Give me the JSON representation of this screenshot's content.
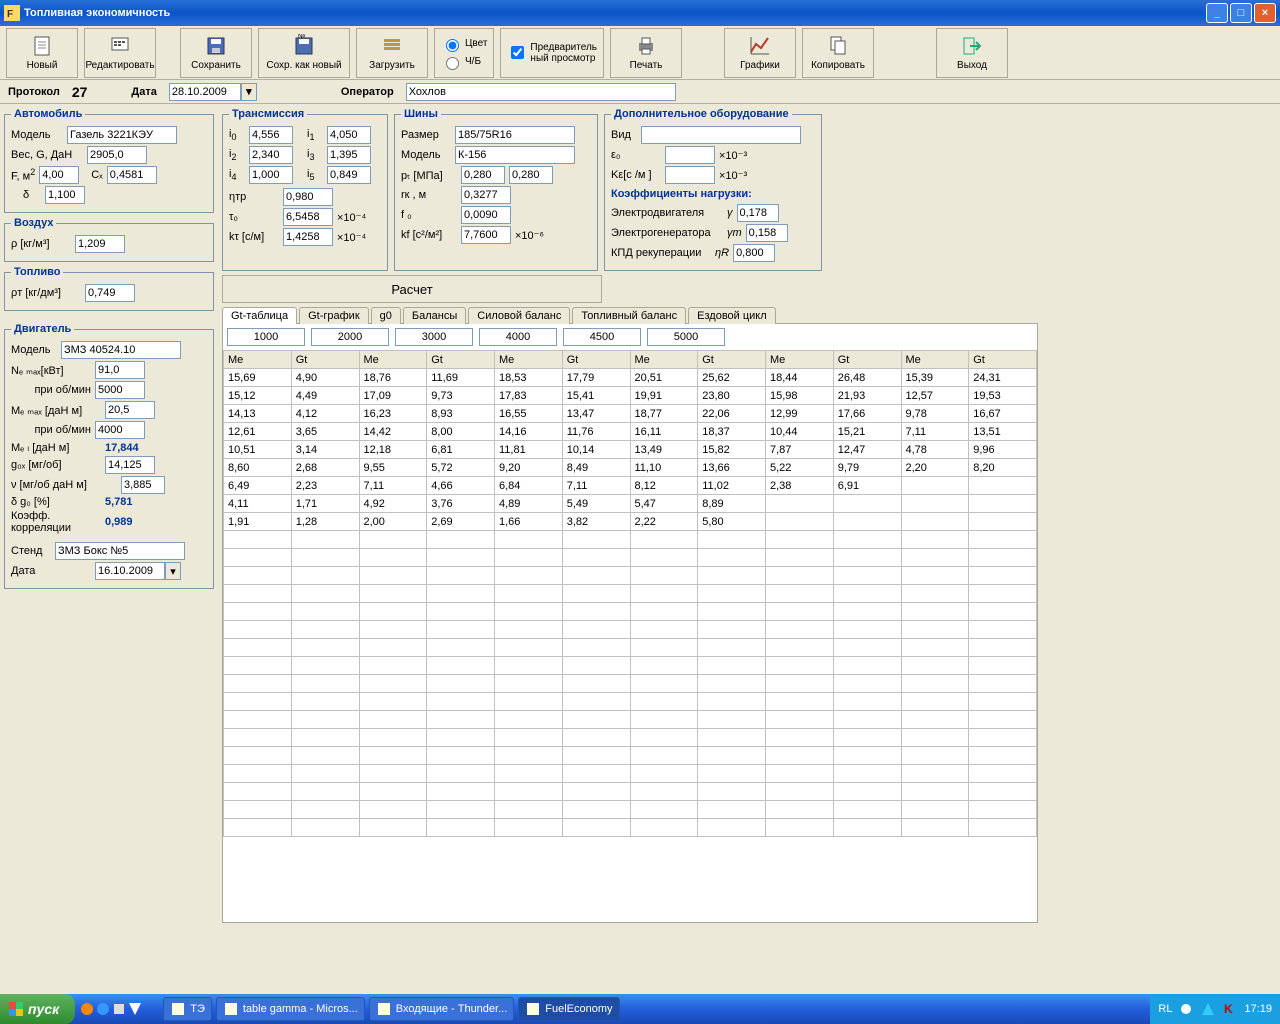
{
  "window": {
    "title": "Топливная экономичность"
  },
  "toolbar": {
    "new": "Новый",
    "edit": "Редактировать",
    "save": "Сохранить",
    "save_as_new": "Сохр. как новый",
    "load": "Загрузить",
    "color": "Цвет",
    "bw": "Ч/Б",
    "preview": "Предваритель\nный просмотр",
    "print": "Печать",
    "graphs": "Графики",
    "copy": "Копировать",
    "exit": "Выход"
  },
  "protobar": {
    "protocol_lbl": "Протокол",
    "protocol_no": "27",
    "date_lbl": "Дата",
    "date": "28.10.2009",
    "operator_lbl": "Оператор",
    "operator": "Хохлов"
  },
  "auto": {
    "legend": "Автомобиль",
    "model_lbl": "Модель",
    "model": "Газель 3221КЭУ",
    "weight_lbl": "Вес, G, ДаН",
    "weight": "2905,0",
    "F_lbl": "F, м",
    "F": "4,00",
    "Cx_lbl": "Cₓ",
    "Cx": "0,4581",
    "delta_lbl": "δ",
    "delta": "1,100"
  },
  "air": {
    "legend": "Воздух",
    "rho_lbl": "ρ  [кг/м³]",
    "rho": "1,209"
  },
  "fuel": {
    "legend": "Топливо",
    "rhoT_lbl": "ρт [кг/дм³]",
    "rhoT": "0,749"
  },
  "trans": {
    "legend": "Трансмиссия",
    "i0": "4,556",
    "i1": "4,050",
    "i2": "2,340",
    "i3": "1,395",
    "i4": "1,000",
    "i5": "0,849",
    "eta_lbl": "ηтр",
    "eta": "0,980",
    "tau_lbl": "τ₀",
    "tau": "6,5458",
    "tau_exp": "×10⁻⁴",
    "kt_lbl": "kτ [с/м]",
    "kt": "1,4258",
    "kt_exp": "×10⁻⁴"
  },
  "tires": {
    "legend": "Шины",
    "size_lbl": "Размер",
    "size": "185/75R16",
    "model_lbl": "Модель",
    "model": "К-156",
    "pt_lbl": "pₜ [МПа]",
    "pt1": "0,280",
    "pt2": "0,280",
    "rk_lbl": "rк , м",
    "rk": "0,3277",
    "f0_lbl": "f ₀",
    "f0": "0,0090",
    "kf_lbl": "kf [с²/м²]",
    "kf": "7,7600",
    "kf_exp": "×10⁻⁶"
  },
  "extra": {
    "legend": "Дополнительное оборудование",
    "kind_lbl": "Вид",
    "kind": "",
    "eps_lbl": "ε₀",
    "eps": "",
    "eps_exp": "×10⁻³",
    "ke_lbl": "Kε[с /м ]",
    "ke": "",
    "ke_exp": "×10⁻³",
    "coeff_hdr": "Коэффициенты нагрузки:",
    "elmot_lbl": "Электродвигателя",
    "elmot_sym": "γ",
    "elmot": "0,178",
    "elgen_lbl": "Электрогенератора",
    "elgen_sym": "γт",
    "elgen": "0,158",
    "kpd_lbl": "КПД рекуперации",
    "kpd_sym": "ηR",
    "kpd": "0,800"
  },
  "calc_btn": "Расчет",
  "engine": {
    "legend": "Двигатель",
    "model_lbl": "Модель",
    "model": "ЗМЗ 40524.10",
    "Nemax_lbl": "Nₑ ₘₐₓ[кВт]",
    "Nemax": "91,0",
    "at_rpm_lbl": "при об/мин",
    "Nemax_rpm": "5000",
    "Memax_lbl": "Mₑ ₘₐₓ [даН м]",
    "Memax": "20,5",
    "Memax_rpm": "4000",
    "MeL_lbl": "Mₑ ₗ   [даН м]",
    "MeL": "17,844",
    "gox_lbl": "g₀ₓ  [мг/об]",
    "gox": "14,125",
    "nu_lbl": "ν   [мг/об даН м]",
    "nu": "3,885",
    "dg0_lbl": "δ g₀  [%]",
    "dg0": "5,781",
    "corr_lbl": "Коэфф.\nкорреляции",
    "corr": "0,989",
    "bench_lbl": "Стенд",
    "bench": "ЗМЗ Бокс №5",
    "date_lbl": "Дата",
    "date": "16.10.2009"
  },
  "tabs": [
    "Gt-таблица",
    "Gt-график",
    "g0",
    "Балансы",
    "Силовой баланс",
    "Топливный баланс",
    "Ездовой цикл"
  ],
  "rpm_headers": [
    "1000",
    "2000",
    "3000",
    "4000",
    "4500",
    "5000"
  ],
  "col_headers": [
    "Me",
    "Gt",
    "Me",
    "Gt",
    "Me",
    "Gt",
    "Me",
    "Gt",
    "Me",
    "Gt",
    "Me",
    "Gt"
  ],
  "table": [
    [
      "15,69",
      "4,90",
      "18,76",
      "11,69",
      "18,53",
      "17,79",
      "20,51",
      "25,62",
      "18,44",
      "26,48",
      "15,39",
      "24,31"
    ],
    [
      "15,12",
      "4,49",
      "17,09",
      "9,73",
      "17,83",
      "15,41",
      "19,91",
      "23,80",
      "15,98",
      "21,93",
      "12,57",
      "19,53"
    ],
    [
      "14,13",
      "4,12",
      "16,23",
      "8,93",
      "16,55",
      "13,47",
      "18,77",
      "22,06",
      "12,99",
      "17,66",
      "9,78",
      "16,67"
    ],
    [
      "12,61",
      "3,65",
      "14,42",
      "8,00",
      "14,16",
      "11,76",
      "16,11",
      "18,37",
      "10,44",
      "15,21",
      "7,11",
      "13,51"
    ],
    [
      "10,51",
      "3,14",
      "12,18",
      "6,81",
      "11,81",
      "10,14",
      "13,49",
      "15,82",
      "7,87",
      "12,47",
      "4,78",
      "9,96"
    ],
    [
      "8,60",
      "2,68",
      "9,55",
      "5,72",
      "9,20",
      "8,49",
      "11,10",
      "13,66",
      "5,22",
      "9,79",
      "2,20",
      "8,20"
    ],
    [
      "6,49",
      "2,23",
      "7,11",
      "4,66",
      "6,84",
      "7,11",
      "8,12",
      "11,02",
      "2,38",
      "6,91",
      "",
      ""
    ],
    [
      "4,11",
      "1,71",
      "4,92",
      "3,76",
      "4,89",
      "5,49",
      "5,47",
      "8,89",
      "",
      "",
      "",
      ""
    ],
    [
      "1,91",
      "1,28",
      "2,00",
      "2,69",
      "1,66",
      "3,82",
      "2,22",
      "5,80",
      "",
      "",
      "",
      ""
    ]
  ],
  "taskbar": {
    "start": "пуск",
    "items": [
      {
        "label": "ТЭ",
        "active": false
      },
      {
        "label": "table gamma - Micros...",
        "active": false
      },
      {
        "label": "Входящие - Thunder...",
        "active": false
      },
      {
        "label": "FuelEconomy",
        "active": true
      }
    ],
    "lang": "RL",
    "time": "17:19"
  }
}
